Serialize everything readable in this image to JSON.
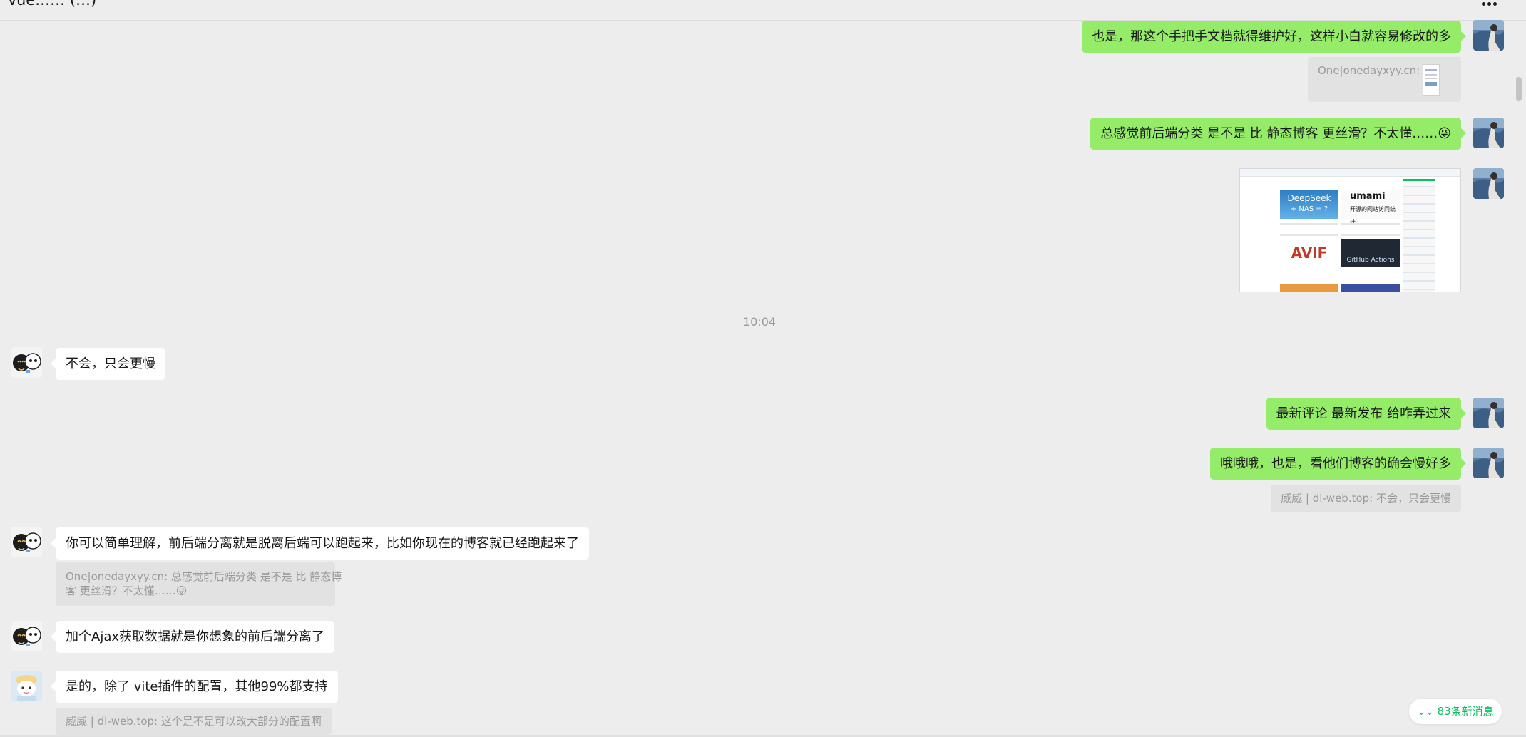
{
  "header": {
    "title": "Vue…… (…)",
    "more_icon": "more-horizontal-icon"
  },
  "time_divider": "10:04",
  "messages": [
    {
      "side": "mine",
      "text": "也是，那这个手把手文档就得维护好，这样小白就容易修改的多"
    },
    {
      "side": "mine",
      "type": "quote",
      "text": "One|onedayxyy.cn:"
    },
    {
      "side": "mine",
      "text": "总感觉前后端分类 是不是 比 静态博客 更丝滑？不太懂……😜"
    },
    {
      "side": "mine",
      "type": "image",
      "image_content": {
        "card_titles": [
          "DeepSeek",
          "+ NAS = ?",
          "umami",
          "开源的网站访问统计",
          "AVIF",
          "GitHub Actions"
        ]
      }
    },
    {
      "side": "theirs",
      "text": "不会，只会更慢"
    },
    {
      "side": "mine",
      "text": "最新评论 最新发布 给咋弄过来"
    },
    {
      "side": "mine",
      "text": "哦哦哦，也是，看他们博客的确会慢好多"
    },
    {
      "side": "mine",
      "type": "quote",
      "text": "威威 | dl-web.top: 不会，只会更慢"
    },
    {
      "side": "theirs",
      "text": "你可以简单理解，前后端分离就是脱离后端可以跑起来，比如你现在的博客就已经跑起来了"
    },
    {
      "side": "theirs",
      "type": "quote",
      "lines": [
        "One|onedayxyy.cn: 总感觉前后端分类 是不是 比 静态博",
        "客 更丝滑？不太懂……😜"
      ]
    },
    {
      "side": "theirs",
      "text": "加个Ajax获取数据就是你想象的前后端分离了"
    },
    {
      "side": "theirs",
      "text": "是的，除了 vite插件的配置，其他99%都支持"
    },
    {
      "side": "theirs",
      "type": "quote",
      "text": "威威 | dl-web.top: 这个是不是可以改大部分的配置啊"
    }
  ],
  "new_messages_button": {
    "icon": "double-chevron-down-icon",
    "label": "83条新消息"
  },
  "colors": {
    "background": "#ededed",
    "my_bubble": "#95ec69",
    "their_bubble": "#ffffff",
    "quote_bg": "#e2e2e2",
    "accent_green": "#07c160"
  }
}
